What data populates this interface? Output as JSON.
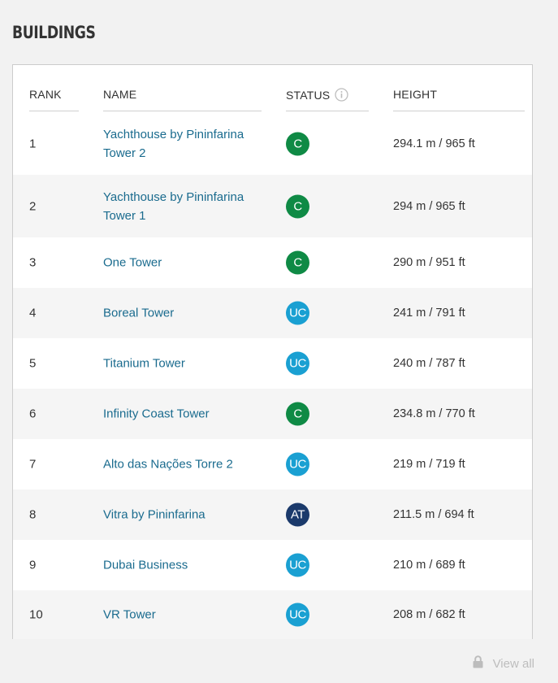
{
  "section": {
    "title": "BUILDINGS"
  },
  "table": {
    "headers": {
      "rank": "RANK",
      "name": "NAME",
      "status": "STATUS",
      "height": "HEIGHT"
    },
    "rows": [
      {
        "rank": "1",
        "name": "Yachthouse by Pininfarina Tower 2",
        "status": "C",
        "height": "294.1 m / 965  ft"
      },
      {
        "rank": "2",
        "name": "Yachthouse by Pininfarina Tower 1",
        "status": "C",
        "height": "294 m / 965  ft"
      },
      {
        "rank": "3",
        "name": "One Tower",
        "status": "C",
        "height": "290 m / 951  ft"
      },
      {
        "rank": "4",
        "name": "Boreal Tower",
        "status": "UC",
        "height": "241 m / 791  ft"
      },
      {
        "rank": "5",
        "name": "Titanium Tower",
        "status": "UC",
        "height": "240 m / 787  ft"
      },
      {
        "rank": "6",
        "name": "Infinity Coast Tower",
        "status": "C",
        "height": "234.8 m / 770  ft"
      },
      {
        "rank": "7",
        "name": "Alto das Nações Torre 2",
        "status": "UC",
        "height": "219 m / 719  ft"
      },
      {
        "rank": "8",
        "name": "Vitra by Pininfarina",
        "status": "AT",
        "height": "211.5 m / 694  ft"
      },
      {
        "rank": "9",
        "name": "Dubai Business",
        "status": "UC",
        "height": "210 m / 689  ft"
      },
      {
        "rank": "10",
        "name": "VR Tower",
        "status": "UC",
        "height": "208 m / 682  ft"
      }
    ]
  },
  "status_colors": {
    "C": "#0f8a45",
    "UC": "#1aa0d2",
    "AT": "#1b3a6b"
  },
  "icons": {
    "status_info": "info-circle-icon",
    "view_all": "lock-icon"
  },
  "footer": {
    "view_all_label": "View all"
  }
}
